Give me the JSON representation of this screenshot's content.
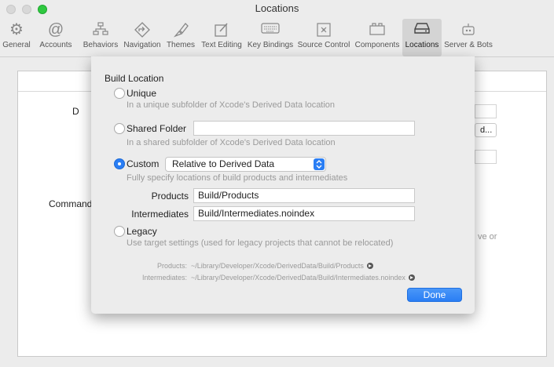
{
  "window": {
    "title": "Locations"
  },
  "toolbar": {
    "tabs": [
      {
        "label": "General",
        "icon": "gear-icon"
      },
      {
        "label": "Accounts",
        "icon": "at-sign-icon"
      },
      {
        "label": "Behaviors",
        "icon": "flowchart-icon"
      },
      {
        "label": "Navigation",
        "icon": "navigation-arrow-icon"
      },
      {
        "label": "Themes",
        "icon": "paintbrush-icon"
      },
      {
        "label": "Text Editing",
        "icon": "edit-icon"
      },
      {
        "label": "Key Bindings",
        "icon": "keyboard-icon"
      },
      {
        "label": "Source Control",
        "icon": "source-control-icon"
      },
      {
        "label": "Components",
        "icon": "components-icon"
      },
      {
        "label": "Locations",
        "icon": "drive-icon"
      },
      {
        "label": "Server & Bots",
        "icon": "bot-icon"
      }
    ],
    "active": "Locations"
  },
  "background": {
    "label_d": "D",
    "label_command": "Command",
    "button_partial": "d...",
    "text_partial": "ve or"
  },
  "sheet": {
    "title": "Build Location",
    "options": {
      "unique": {
        "label": "Unique",
        "description": "In a unique subfolder of Xcode's Derived Data location"
      },
      "shared": {
        "label": "Shared Folder",
        "value": "",
        "description": "In a shared subfolder of Xcode's Derived Data location"
      },
      "custom": {
        "label": "Custom",
        "popup_value": "Relative to Derived Data",
        "description": "Fully specify locations of build products and intermediates"
      },
      "legacy": {
        "label": "Legacy",
        "description": "Use target settings (used for legacy projects that cannot be relocated)"
      }
    },
    "selected": "Custom",
    "fields": {
      "products_label": "Products",
      "products_value": "Build/Products",
      "intermediates_label": "Intermediates",
      "intermediates_value": "Build/Intermediates.noindex"
    },
    "paths": {
      "products_label": "Products:",
      "products_path": "~/Library/Developer/Xcode/DerivedData/Build/Products",
      "intermediates_label": "Intermediates:",
      "intermediates_path": "~/Library/Developer/Xcode/DerivedData/Build/Intermediates.noindex"
    },
    "done_label": "Done"
  },
  "colors": {
    "accent": "#2a7ef4",
    "window_bg": "#ececec"
  }
}
